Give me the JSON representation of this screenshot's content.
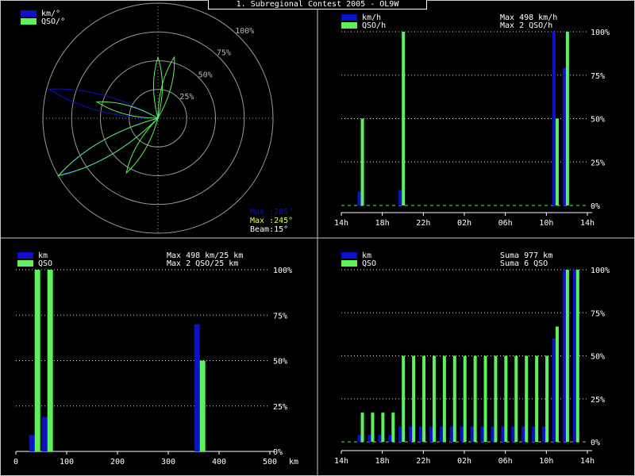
{
  "header": {
    "title": "1. Subregional Contest 2005 - OL9W"
  },
  "colors": {
    "km": "#0b12c8",
    "qso": "#5cf05c",
    "grid": "#9a9a9a",
    "text": "#ffffff",
    "bg": "#000000",
    "max_label": "#e8ff5a"
  },
  "chart_data": [
    {
      "id": "polar",
      "type": "polar",
      "legend": [
        {
          "label": "km/°",
          "color": "#0b12c8"
        },
        {
          "label": "QSO/°",
          "color": "#5cf05c"
        }
      ],
      "ring_labels": [
        "25%",
        "50%",
        "75%",
        "100%"
      ],
      "series": [
        {
          "name": "km/°",
          "lobes": [
            {
              "azimuth": 285,
              "value": 0.98
            },
            {
              "azimuth": 240,
              "value": 0.98
            }
          ]
        },
        {
          "name": "QSO/°",
          "lobes": [
            {
              "azimuth": 285,
              "value": 0.55
            },
            {
              "azimuth": 240,
              "value": 1.0
            },
            {
              "azimuth": 210,
              "value": 0.55
            },
            {
              "azimuth": 15,
              "value": 0.55
            },
            {
              "azimuth": 0,
              "value": 0.53
            }
          ]
        }
      ],
      "beam_deg": 15,
      "max_km_label": "Max :285°",
      "max_qso_label": "Max :245°",
      "beam_label": "Beam:15°"
    },
    {
      "id": "per-hour",
      "type": "bar",
      "legend": [
        {
          "label": "km/h",
          "color": "#0b12c8"
        },
        {
          "label": "QSO/h",
          "color": "#5cf05c"
        }
      ],
      "stats": [
        "Max   498 km/h",
        "Max    2 QSO/h"
      ],
      "y_ticks": [
        "0%",
        "25%",
        "50%",
        "75%",
        "100%"
      ],
      "x_ticks": [
        "14h",
        "18h",
        "22h",
        "02h",
        "06h",
        "10h",
        "14h"
      ],
      "x_range": [
        0,
        24
      ],
      "bars": [
        {
          "x": 1.9,
          "km": 8,
          "qso": 50
        },
        {
          "x": 5.9,
          "km": 9,
          "qso": 100
        },
        {
          "x": 20.9,
          "km": 100,
          "qso": 50
        },
        {
          "x": 21.9,
          "km": 79,
          "qso": 100
        }
      ]
    },
    {
      "id": "per-distance",
      "type": "bar",
      "legend": [
        {
          "label": "km",
          "color": "#0b12c8"
        },
        {
          "label": "QSO",
          "color": "#5cf05c"
        }
      ],
      "stats": [
        "Max   498 km/25 km",
        "Max    2 QSO/25 km"
      ],
      "y_ticks": [
        "0%",
        "25%",
        "50%",
        "75%",
        "100%"
      ],
      "x_ticks": [
        "0",
        "100",
        "200",
        "300",
        "400",
        "500"
      ],
      "x_unit": "km",
      "x_range": [
        0,
        500
      ],
      "bars": [
        {
          "x": 37,
          "km": 9,
          "qso": 100
        },
        {
          "x": 62,
          "km": 19,
          "qso": 100
        },
        {
          "x": 362,
          "km": 70,
          "qso": 50
        }
      ]
    },
    {
      "id": "cumulative",
      "type": "bar",
      "legend": [
        {
          "label": "km",
          "color": "#0b12c8"
        },
        {
          "label": "QSO",
          "color": "#5cf05c"
        }
      ],
      "stats": [
        "Suma    977 km",
        "Suma     6 QSO"
      ],
      "y_ticks": [
        "0%",
        "25%",
        "50%",
        "75%",
        "100%"
      ],
      "x_ticks": [
        "14h",
        "18h",
        "22h",
        "02h",
        "06h",
        "10h",
        "14h"
      ],
      "x_range": [
        0,
        24
      ],
      "bars": [
        {
          "x": 1.9,
          "km": 4,
          "qso": 17
        },
        {
          "x": 2.9,
          "km": 4,
          "qso": 17
        },
        {
          "x": 3.9,
          "km": 4,
          "qso": 17
        },
        {
          "x": 4.9,
          "km": 4,
          "qso": 17
        },
        {
          "x": 5.9,
          "km": 9,
          "qso": 50
        },
        {
          "x": 6.9,
          "km": 9,
          "qso": 50
        },
        {
          "x": 7.9,
          "km": 9,
          "qso": 50
        },
        {
          "x": 8.9,
          "km": 9,
          "qso": 50
        },
        {
          "x": 9.9,
          "km": 9,
          "qso": 50
        },
        {
          "x": 10.9,
          "km": 9,
          "qso": 50
        },
        {
          "x": 11.9,
          "km": 9,
          "qso": 50
        },
        {
          "x": 12.9,
          "km": 9,
          "qso": 50
        },
        {
          "x": 13.9,
          "km": 9,
          "qso": 50
        },
        {
          "x": 14.9,
          "km": 9,
          "qso": 50
        },
        {
          "x": 15.9,
          "km": 9,
          "qso": 50
        },
        {
          "x": 16.9,
          "km": 9,
          "qso": 50
        },
        {
          "x": 17.9,
          "km": 9,
          "qso": 50
        },
        {
          "x": 18.9,
          "km": 9,
          "qso": 50
        },
        {
          "x": 19.9,
          "km": 9,
          "qso": 50
        },
        {
          "x": 20.9,
          "km": 60,
          "qso": 67
        },
        {
          "x": 21.9,
          "km": 100,
          "qso": 100
        },
        {
          "x": 22.9,
          "km": 100,
          "qso": 100
        }
      ]
    }
  ]
}
